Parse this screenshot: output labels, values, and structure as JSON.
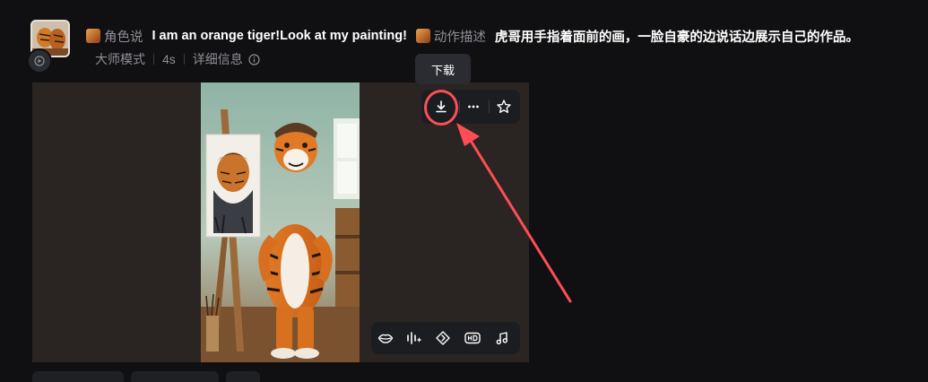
{
  "header": {
    "role_label": "角色说",
    "speech": "I am an orange tiger!Look at my painting!",
    "action_label": "动作描述",
    "action_text": "虎哥用手指着面前的画，一脸自豪的边说话边展示自己的作品。"
  },
  "meta": {
    "mode": "大师模式",
    "duration": "4s",
    "details": "详细信息"
  },
  "tooltip": {
    "download": "下载"
  },
  "icons": {
    "top_toolbar": [
      "download-icon",
      "more-icon",
      "star-icon"
    ],
    "bottom_toolbar": [
      "lips-icon",
      "audio-sparkle-icon",
      "extend-icon",
      "hd-icon",
      "music-icon"
    ]
  },
  "colors": {
    "background": "#101012",
    "card": "#2a2522",
    "toolbar": "#1c1d21",
    "annotation": "#ff4d57",
    "muted_text": "#8e8f96"
  }
}
